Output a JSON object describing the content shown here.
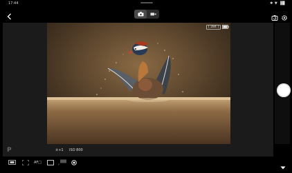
{
  "status": {
    "time": "17:44",
    "icons": "✱ ▼ ▐█"
  },
  "top": {
    "modes": [
      {
        "name": "photo",
        "icon": "camera-icon",
        "active": true
      },
      {
        "name": "video",
        "icon": "video-icon",
        "active": false
      }
    ],
    "right_icons": [
      "camera-switch-icon",
      "settings-gear-icon"
    ]
  },
  "viewfinder": {
    "shots_remaining": "[ 284 ]",
    "battery_icon": "battery-icon"
  },
  "info": {
    "shooting_mode": "P",
    "exposure_comp": "±+1",
    "iso": "ISO 800"
  },
  "toolbar": {
    "items": [
      {
        "icon": "metering-icon"
      },
      {
        "icon": "focus-frame-icon"
      },
      {
        "icon": "af-mode-icon",
        "label": "AF□"
      },
      {
        "icon": "aspect-ratio-icon"
      },
      {
        "icon": "drive-mode-icon"
      },
      {
        "icon": "timer-icon"
      }
    ],
    "expand_icon": "caret-down-icon"
  },
  "colors": {
    "shutter": "#ffffff",
    "panel": "#1b1b1b",
    "accent": "#c9a56a"
  }
}
